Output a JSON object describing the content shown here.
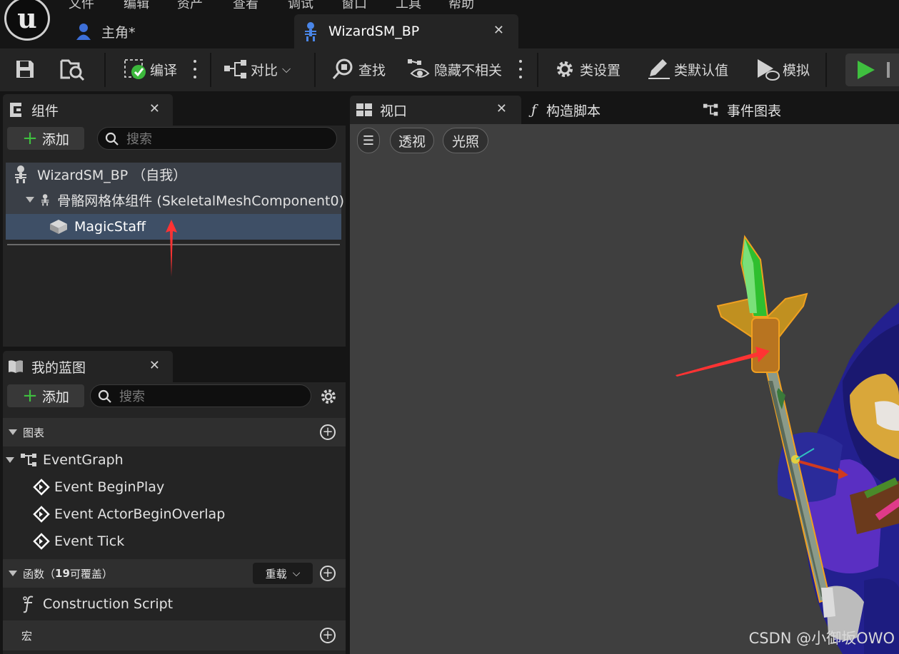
{
  "app": {
    "logo_letter": "u",
    "menu": [
      "文件",
      "编辑",
      "资产",
      "查看",
      "调试",
      "窗口",
      "工具",
      "帮助"
    ]
  },
  "doc_tabs": [
    {
      "label": "主角*",
      "icon": "character-icon",
      "active": false
    },
    {
      "label": "WizardSM_BP",
      "icon": "skeleton-icon",
      "active": true
    }
  ],
  "toolbar": {
    "compile": "编译",
    "diff": "对比",
    "find": "查找",
    "hide_unrelated": "隐藏不相关",
    "class_settings": "类设置",
    "class_defaults": "类默认值",
    "simulate": "模拟"
  },
  "components_panel": {
    "title": "组件",
    "add_label": "添加",
    "search_placeholder": "搜索",
    "tree": [
      {
        "label": "WizardSM_BP （自我）",
        "icon": "skeleton-icon"
      },
      {
        "label": "骨骼网格体组件 (SkeletalMeshComponent0)",
        "icon": "skeleton-icon"
      },
      {
        "label": "MagicStaff",
        "icon": "static-mesh-icon",
        "selected": true
      }
    ]
  },
  "blueprint_panel": {
    "title": "我的蓝图",
    "add_label": "添加",
    "search_placeholder": "搜索",
    "sections": {
      "graphs": "图表",
      "functions": "函数（",
      "functions_count": "19",
      "functions_suffix": "可覆盖）",
      "override_label": "重载",
      "macros": "宏"
    },
    "event_graph": "EventGraph",
    "events": [
      "Event BeginPlay",
      "Event ActorBeginOverlap",
      "Event Tick"
    ],
    "construction_script": "Construction Script"
  },
  "viewport_tabs": {
    "viewport": "视口",
    "construction": "构造脚本",
    "event_graph": "事件图表"
  },
  "viewport": {
    "perspective": "透视",
    "lit": "光照",
    "watermark": "CSDN @小御坂OWO"
  },
  "colors": {
    "accent_selected": "#3e4f66",
    "tree_bg": "#3a3f47",
    "play_green": "#3fbf3f",
    "annotation_arrow": "#ff3333",
    "selection_outline": "#f0a020"
  }
}
